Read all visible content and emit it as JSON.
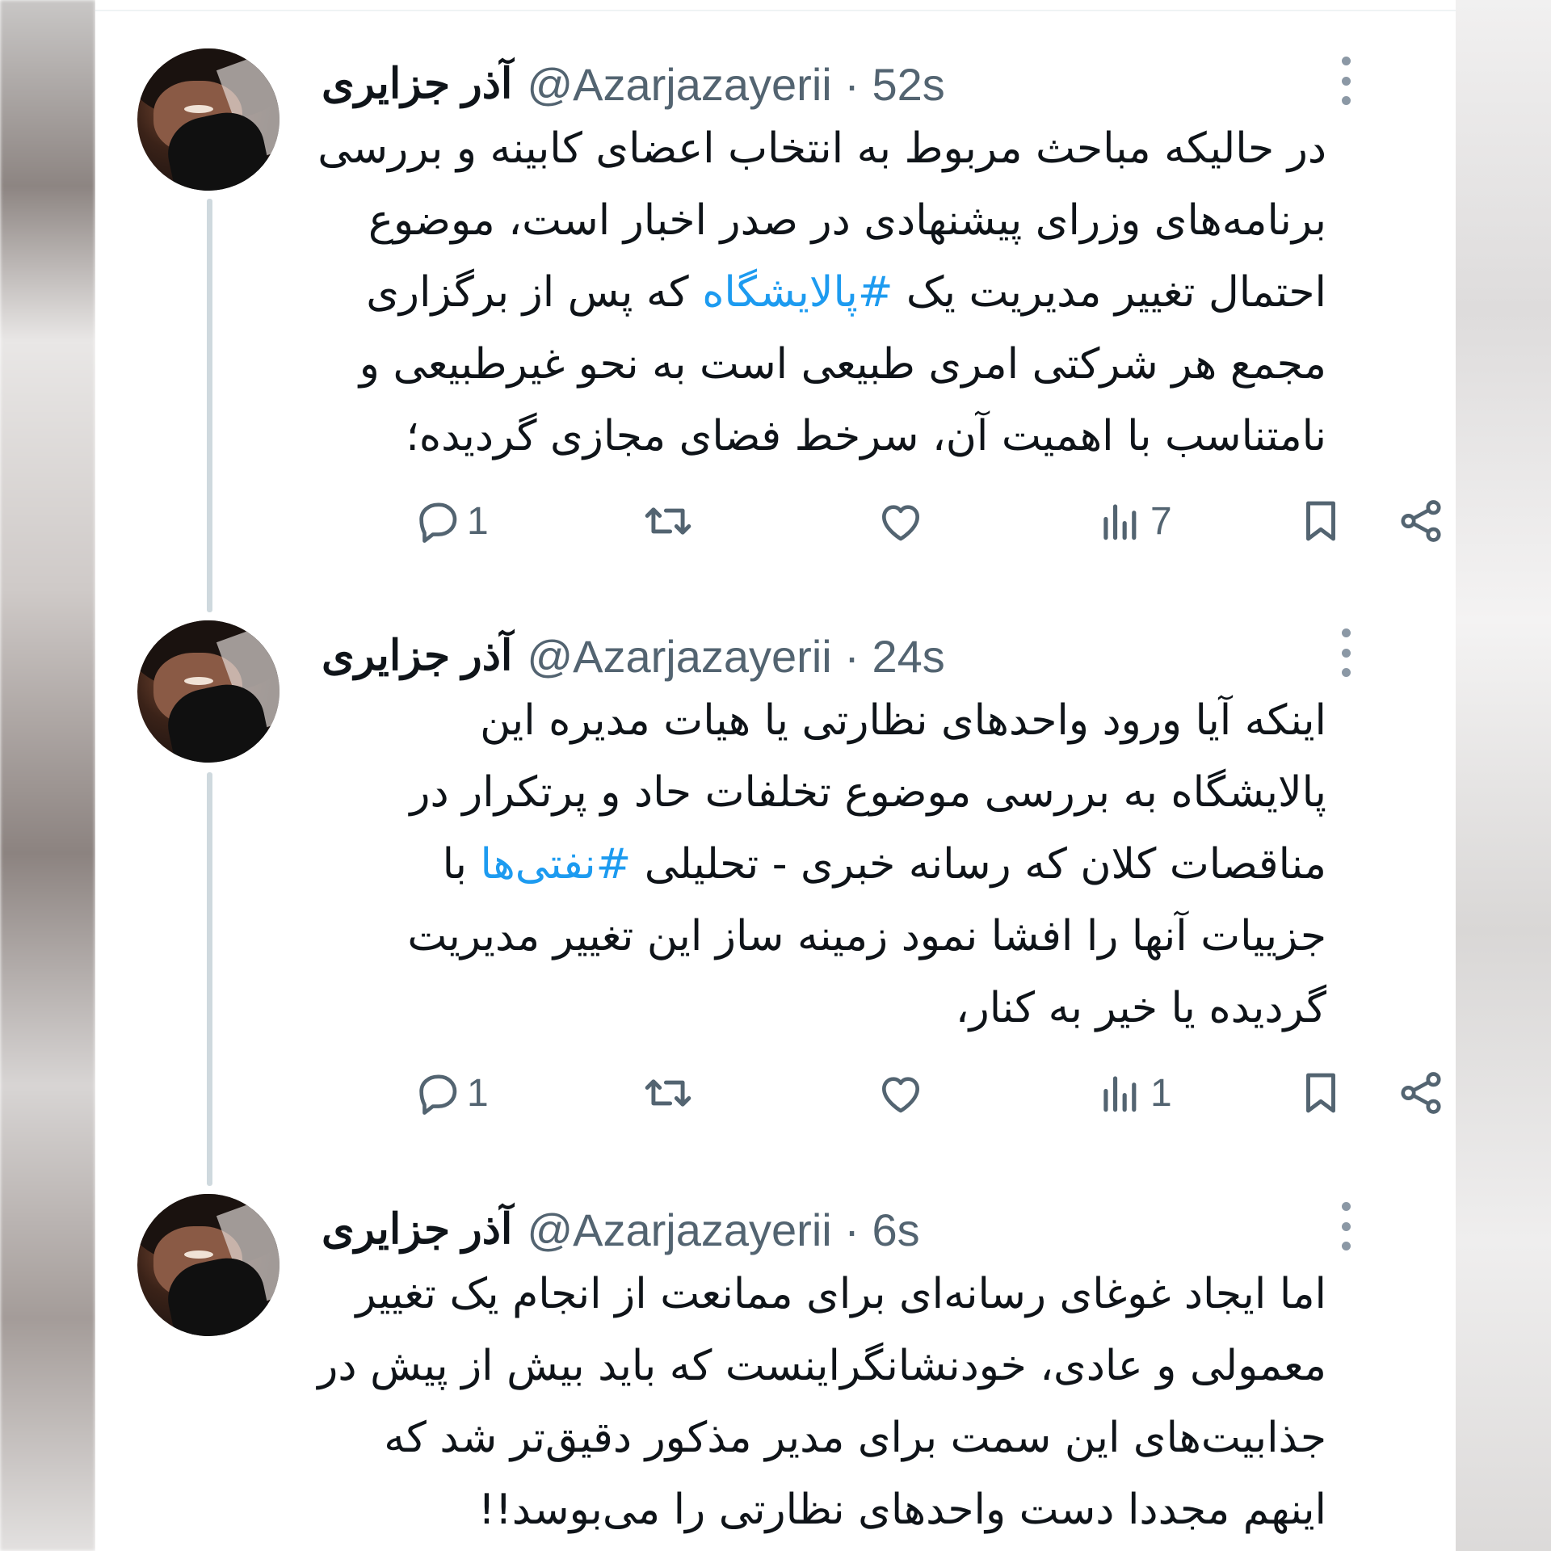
{
  "tweets": [
    {
      "name": "آذر جزایری",
      "handle": "@Azarjazayerii · 52s",
      "lines": [
        "در حالیکه مباحث مربوط به انتخاب اعضای کابینه و بررسی",
        "برنامه‌های وزرای پیشنهادی در صدر اخبار است، موضوع",
        {
          "before": "احتمال تغییر مدیریت یک ",
          "hashtag": "#پالایشگاه",
          "after": " که پس از برگزاری"
        },
        "مجمع هر شرکتی امری طبیعی است به نحو غیرطبیعی و",
        "نامتناسب با اهمیت آن، سرخط فضای مجازی گردیده؛"
      ],
      "replies": "1",
      "views": "7"
    },
    {
      "name": "آذر جزایری",
      "handle": "@Azarjazayerii · 24s",
      "lines": [
        "اینکه آیا ورود واحدهای نظارتی یا هیات مدیره این",
        "پالایشگاه به بررسی موضوع تخلفات حاد و پرتکرار در",
        {
          "before": "مناقصات کلان که رسانه خبری - تحلیلی ",
          "hashtag": "#نفتی‌ها",
          "after": " با"
        },
        "جزییات آنها را افشا نمود زمینه ساز این تغییر مدیریت",
        "گردیده یا خیر به کنار،"
      ],
      "replies": "1",
      "views": "1"
    },
    {
      "name": "آذر جزایری",
      "handle": "@Azarjazayerii · 6s",
      "lines": [
        "اما ایجاد غوغای رسانه‌ای برای ممانعت از انجام یک تغییر",
        "معمولی و عادی، خودنشانگراینست که باید بیش از پیش در",
        "جذابیت‌های این سمت برای مدیر مذکور دقیق‌تر شد که",
        "اینهم مجددا دست واحدهای نظارتی را می‌بوسد!!"
      ]
    }
  ],
  "icons": [
    "reply-icon",
    "retweet-icon",
    "like-icon",
    "views-icon",
    "bookmark-icon",
    "share-icon",
    "more-icon"
  ],
  "colors": {
    "text": "#0f1419",
    "secondary": "#536471",
    "hashtag": "#1d9bf0",
    "thread_line": "#cfd9de"
  }
}
